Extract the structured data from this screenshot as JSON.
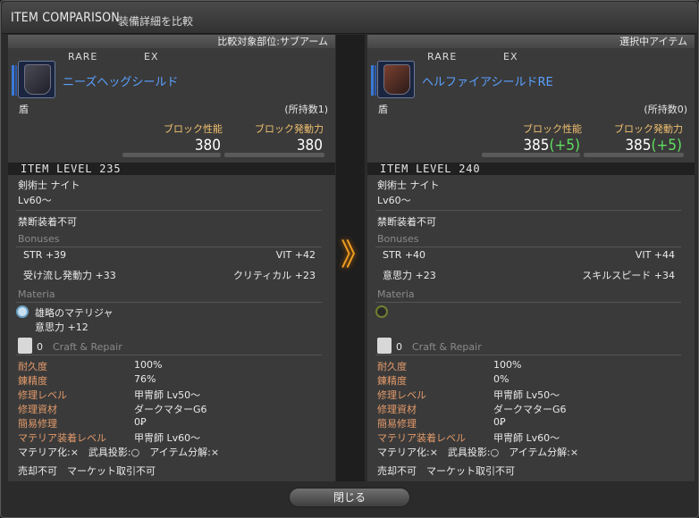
{
  "window": {
    "title_en": "ITEM COMPARISON",
    "title_jp": "装備詳細を比較"
  },
  "left": {
    "header": "比較対象部位:サブアーム",
    "rarity": "RARE",
    "ex": "EX",
    "name": "ニーズヘッグシールド",
    "category": "盾",
    "owned": "(所持数1)",
    "block_rate_label": "ブロック性能",
    "block_chance_label": "ブロック発動力",
    "block_rate": "380",
    "block_chance": "380",
    "block_rate_diff": "",
    "block_chance_diff": "",
    "item_level": "ITEM LEVEL 235",
    "jobs": "剣術士 ナイト",
    "level": "Lv60～",
    "restriction": "禁断装着不可",
    "bonuses_label": "Bonuses",
    "bonuses": [
      [
        "STR +39",
        "VIT +42"
      ],
      [
        "受け流し発動力 +33",
        "クリティカル +23"
      ]
    ],
    "materia_label": "Materia",
    "materia_name": "雄略のマテリジャ",
    "materia_stat": "意思力 +12",
    "craft_count": "0",
    "craft_label": "Craft & Repair",
    "repair": [
      {
        "k": "耐久度",
        "v": "100%"
      },
      {
        "k": "錬精度",
        "v": "76%"
      },
      {
        "k": "修理レベル",
        "v": "甲冑師 Lv50～"
      },
      {
        "k": "修理資材",
        "v": "ダークマターG6"
      },
      {
        "k": "簡易修理",
        "v": "0Ꝑ"
      },
      {
        "k": "マテリア装着レベル",
        "v": "甲冑師 Lv60～"
      }
    ],
    "flags": "マテリア化:×　武具投影:○　アイテム分解:×",
    "trade": "売却不可　マーケット取引不可"
  },
  "right": {
    "header": "選択中アイテム",
    "rarity": "RARE",
    "ex": "EX",
    "name": "ヘルファイアシールドRE",
    "category": "盾",
    "owned": "(所持数0)",
    "block_rate_label": "ブロック性能",
    "block_chance_label": "ブロック発動力",
    "block_rate": "385",
    "block_chance": "385",
    "block_rate_diff": "(+5)",
    "block_chance_diff": "(+5)",
    "item_level": "ITEM LEVEL 240",
    "jobs": "剣術士 ナイト",
    "level": "Lv60～",
    "restriction": "禁断装着不可",
    "bonuses_label": "Bonuses",
    "bonuses": [
      [
        "STR +40",
        "VIT +44"
      ],
      [
        "意思力 +23",
        "スキルスピード +34"
      ]
    ],
    "materia_label": "Materia",
    "craft_count": "0",
    "craft_label": "Craft & Repair",
    "repair": [
      {
        "k": "耐久度",
        "v": "100%"
      },
      {
        "k": "錬精度",
        "v": "0%"
      },
      {
        "k": "修理レベル",
        "v": "甲冑師 Lv50～"
      },
      {
        "k": "修理資材",
        "v": "ダークマターG6"
      },
      {
        "k": "簡易修理",
        "v": "0Ꝑ"
      },
      {
        "k": "マテリア装着レベル",
        "v": "甲冑師 Lv60～"
      }
    ],
    "flags": "マテリア化:×　武具投影:○　アイテム分解:×",
    "trade": "売却不可　マーケット取引不可"
  },
  "arrow": "》",
  "close_label": "閉じる"
}
